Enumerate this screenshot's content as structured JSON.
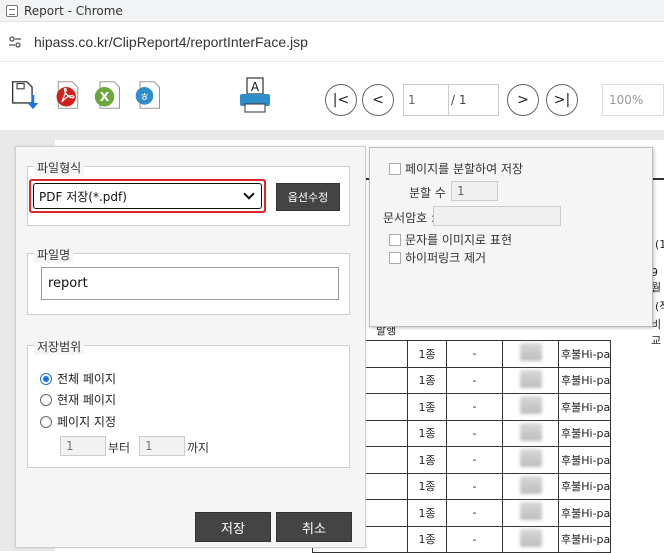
{
  "window": {
    "title": "Report - Chrome"
  },
  "address": {
    "url": "hipass.co.kr/ClipReport4/reportInterFace.jsp"
  },
  "toolbar": {
    "print_icon_letter": "A",
    "page_current": "1",
    "page_total": "/ 1",
    "zoom": "100%"
  },
  "save_dialog": {
    "format_group_label": "파일형식",
    "format_selected": "PDF 저장(*.pdf)",
    "option_edit_button": "옵션수정",
    "filename_group_label": "파일명",
    "filename_value": "report",
    "range_group_label": "저장범위",
    "range_options": [
      "전체 페이지",
      "현재 페이지",
      "페이지 지정"
    ],
    "range_selected_index": 0,
    "range_from": "1",
    "range_from_suffix": "부터",
    "range_to": "1",
    "range_to_suffix": "까지",
    "save_button": "저장",
    "cancel_button": "취소"
  },
  "pdf_options": {
    "split_pages_label": "페이지를 분할하여 저장",
    "split_count_label": "분할 수 :",
    "split_count_value": "1",
    "password_label": "문서암호 :",
    "password_value": "",
    "text_as_image_label": "문자를 이미지로 표현",
    "remove_hyperlink_label": "하이퍼링크 제거"
  },
  "report": {
    "header_fragments": [
      "(1",
      "발행",
      "9월",
      "(적",
      "비교"
    ],
    "rows": [
      {
        "qty": "1종",
        "dash": "-",
        "name": "후불Hi-pa"
      },
      {
        "qty": "1종",
        "dash": "-",
        "name": "후불Hi-pa"
      },
      {
        "qty": "1종",
        "dash": "-",
        "name": "후불Hi-pa"
      },
      {
        "qty": "1종",
        "dash": "-",
        "name": "후불Hi-pa"
      },
      {
        "qty": "1종",
        "dash": "-",
        "name": "후불Hi-pa"
      },
      {
        "qty": "1종",
        "dash": "-",
        "name": "후불Hi-pa"
      },
      {
        "qty": "1종",
        "dash": "-",
        "name": "후불Hi-pa"
      },
      {
        "qty": "1종",
        "dash": "-",
        "name": "후불Hi-pa"
      }
    ]
  },
  "colors": {
    "accent_red": "#e0242b",
    "radio_blue": "#1a73e8",
    "button_dark": "#444444"
  }
}
